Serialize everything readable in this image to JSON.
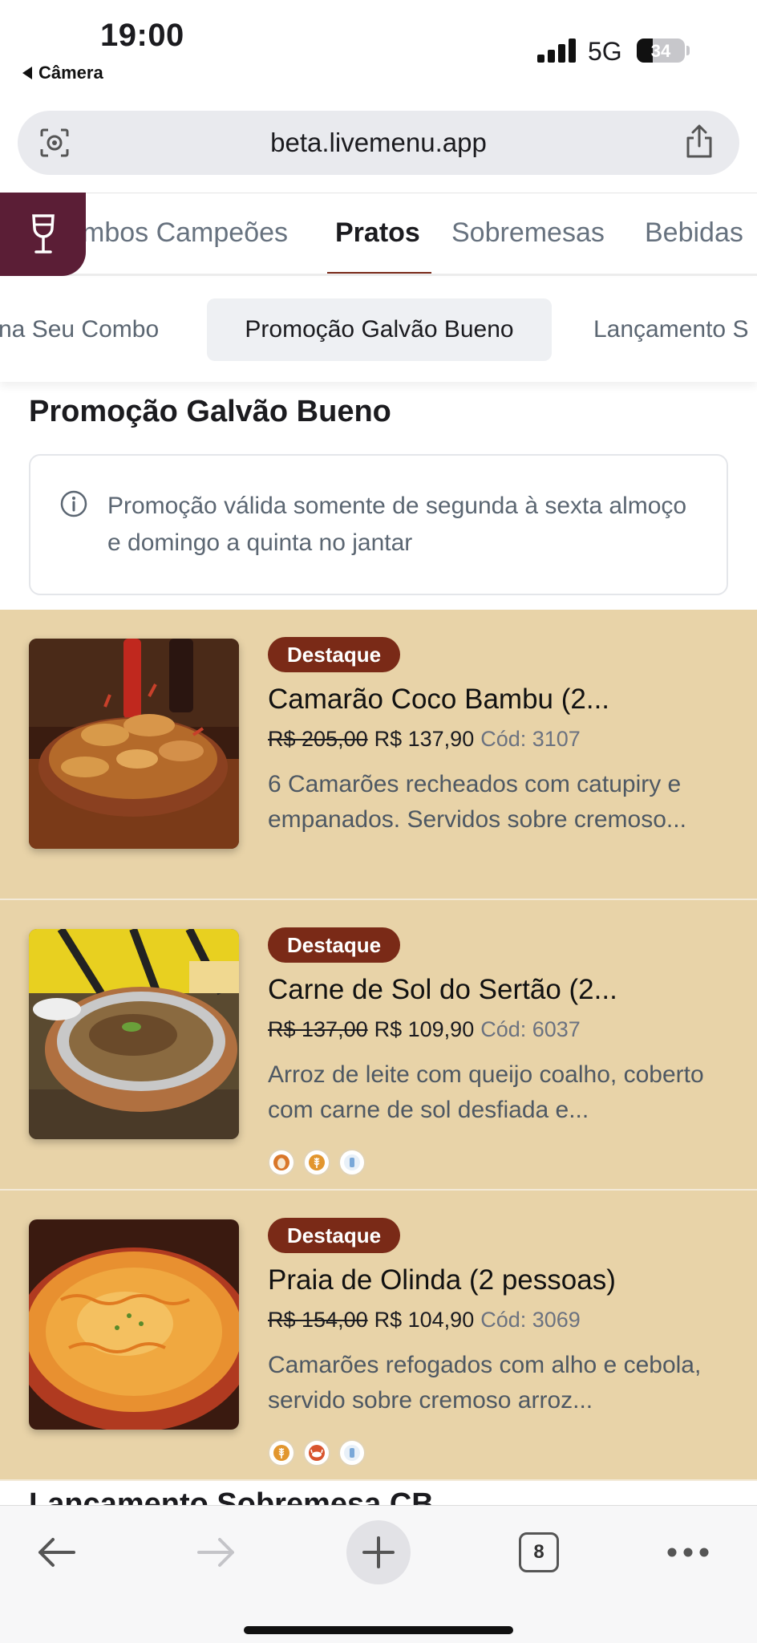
{
  "status_bar": {
    "time": "19:00",
    "back_app": "Câmera",
    "network": "5G",
    "battery": "34",
    "battery_level": 0.34
  },
  "browser": {
    "url": "beta.livemenu.app",
    "tabs_count": "8"
  },
  "category_tabs": [
    {
      "label": "mbos Campeões",
      "active": false
    },
    {
      "label": "Pratos",
      "active": true
    },
    {
      "label": "Sobremesas",
      "active": false
    },
    {
      "label": "Bebidas",
      "active": false
    }
  ],
  "sub_tabs": [
    {
      "label": "na Seu Combo",
      "active": false
    },
    {
      "label": "Promoção Galvão Bueno",
      "active": true
    },
    {
      "label": "Lançamento S",
      "active": false
    }
  ],
  "section": {
    "title": "Promoção Galvão Bueno",
    "notice": "Promoção válida somente de segunda à sexta almoço e domingo a quinta no jantar"
  },
  "items": [
    {
      "badge": "Destaque",
      "name": "Camarão Coco Bambu (2...",
      "old_price": "R$ 205,00",
      "new_price": "R$ 137,90",
      "code": "Cód: 3107",
      "description": "6 Camarões recheados com catupiry e empanados. Servidos sobre cremoso...",
      "allergens": []
    },
    {
      "badge": "Destaque",
      "name": "Carne de Sol do Sertão (2...",
      "old_price": "R$ 137,00",
      "new_price": "R$ 109,90",
      "code": "Cód: 6037",
      "description": "Arroz de leite com queijo coalho, coberto com carne de sol desfiada e...",
      "allergens": [
        "egg-icon",
        "wheat-icon",
        "milk-icon"
      ]
    },
    {
      "badge": "Destaque",
      "name": "Praia de Olinda (2 pessoas)",
      "old_price": "R$ 154,00",
      "new_price": "R$ 104,90",
      "code": "Cód: 3069",
      "description": "Camarões refogados com alho e cebola, servido sobre cremoso arroz...",
      "allergens": [
        "wheat-icon",
        "crab-icon",
        "milk-icon"
      ]
    }
  ],
  "next_section": {
    "title": "Lancamento Sobremesa CB"
  },
  "colors": {
    "wine_button": "#5b1e36",
    "badge": "#7a2a17",
    "item_background": "#e8d3a8",
    "tab_underline": "#7a2a1a"
  }
}
